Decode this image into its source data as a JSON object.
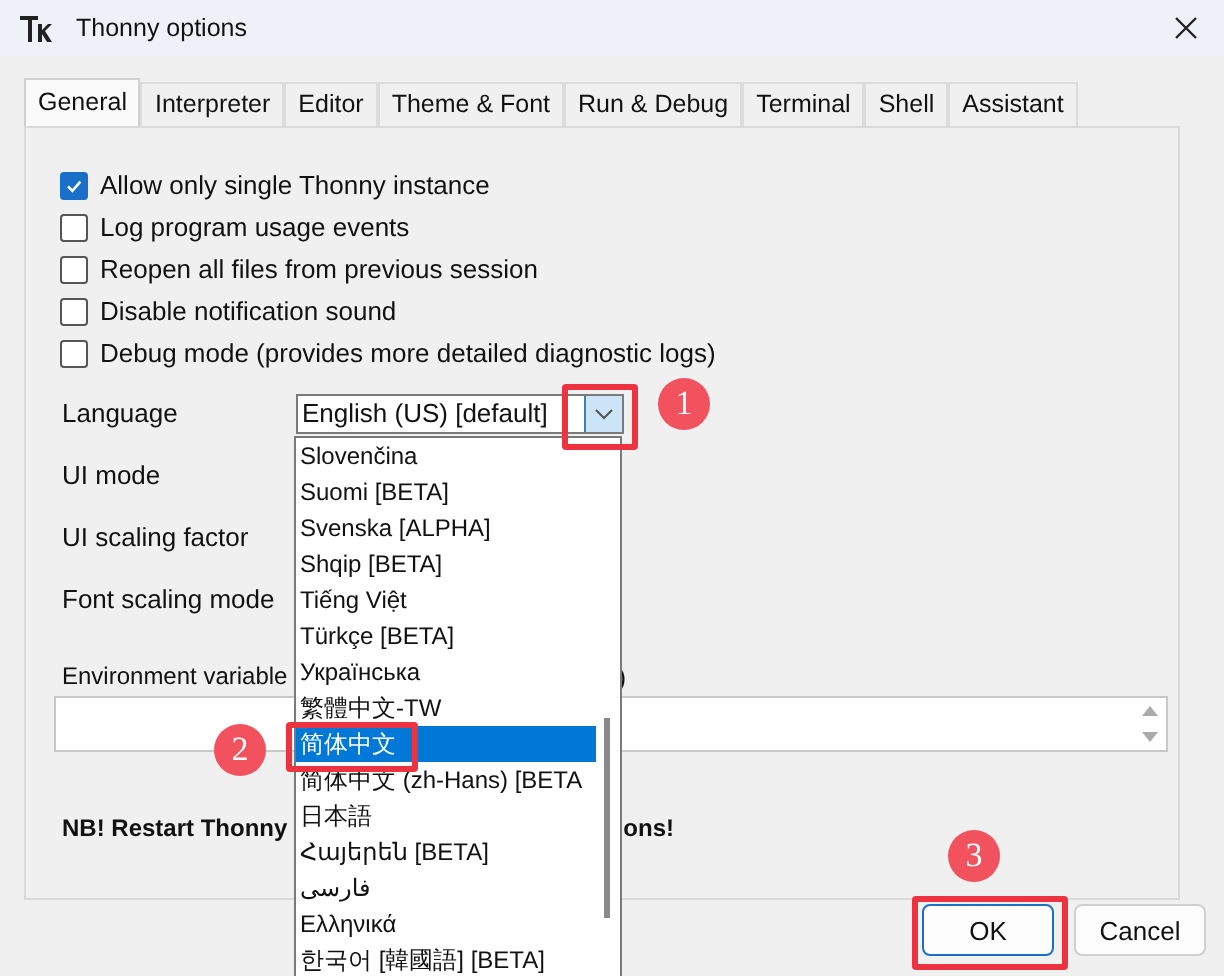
{
  "window": {
    "title": "Thonny options"
  },
  "tabs": [
    {
      "label": "General",
      "selected": true
    },
    {
      "label": "Interpreter",
      "selected": false
    },
    {
      "label": "Editor",
      "selected": false
    },
    {
      "label": "Theme & Font",
      "selected": false
    },
    {
      "label": "Run & Debug",
      "selected": false
    },
    {
      "label": "Terminal",
      "selected": false
    },
    {
      "label": "Shell",
      "selected": false
    },
    {
      "label": "Assistant",
      "selected": false
    }
  ],
  "checkboxes": [
    {
      "label": "Allow only single Thonny instance",
      "checked": true
    },
    {
      "label": "Log program usage events",
      "checked": false
    },
    {
      "label": "Reopen all files from previous session",
      "checked": false
    },
    {
      "label": "Disable notification sound",
      "checked": false
    },
    {
      "label": "Debug mode (provides more detailed diagnostic logs)",
      "checked": false
    }
  ],
  "language": {
    "label": "Language",
    "value": "English (US) [default]"
  },
  "settings": [
    {
      "label": "UI mode"
    },
    {
      "label": "UI scaling factor"
    },
    {
      "label": "Font scaling mode"
    }
  ],
  "environment": {
    "label": "Environment variable",
    "label_tail": ")"
  },
  "notice": {
    "text": "NB! Restart Thonny",
    "tail": "ons!"
  },
  "dropdown": {
    "items": [
      {
        "label": "Slovenčina",
        "selected": false
      },
      {
        "label": "Suomi [BETA]",
        "selected": false
      },
      {
        "label": "Svenska [ALPHA]",
        "selected": false
      },
      {
        "label": "Shqip [BETA]",
        "selected": false
      },
      {
        "label": "Tiếng Việt",
        "selected": false
      },
      {
        "label": "Türkçe [BETA]",
        "selected": false
      },
      {
        "label": "Українська",
        "selected": false
      },
      {
        "label": "繁體中文-TW",
        "selected": false
      },
      {
        "label": "简体中文",
        "selected": true
      },
      {
        "label": "简体中文 (zh-Hans) [BETA",
        "selected": false
      },
      {
        "label": "日本語",
        "selected": false
      },
      {
        "label": "Հայերեն [BETA]",
        "selected": false
      },
      {
        "label": "فارسی",
        "selected": false
      },
      {
        "label": "Ελληνικά",
        "selected": false
      },
      {
        "label": "한국어 [韓國語] [BETA]",
        "selected": false
      }
    ]
  },
  "annotations": [
    {
      "number": "1"
    },
    {
      "number": "2"
    },
    {
      "number": "3"
    }
  ],
  "buttons": [
    {
      "label": "OK",
      "kind": "default"
    },
    {
      "label": "Cancel",
      "kind": "normal"
    }
  ]
}
